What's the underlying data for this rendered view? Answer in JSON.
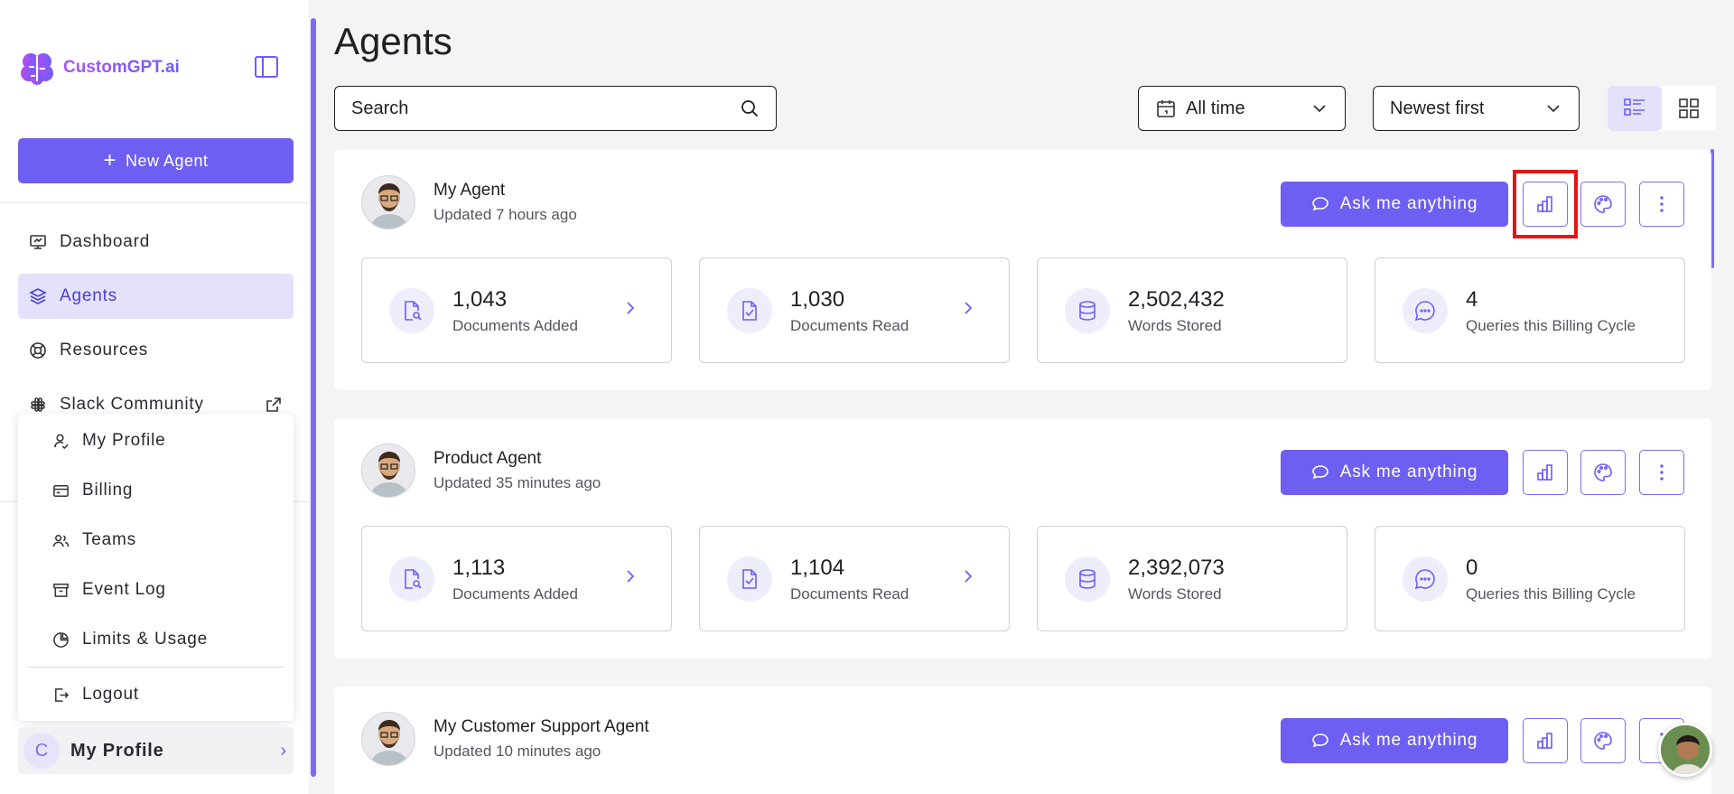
{
  "brand": {
    "name": "CustomGPT.ai"
  },
  "sidebar": {
    "new_agent_label": "New Agent",
    "nav": [
      {
        "label": "Dashboard",
        "icon": "dashboard-icon"
      },
      {
        "label": "Agents",
        "icon": "layers-icon",
        "active": true
      },
      {
        "label": "Resources",
        "icon": "lifebuoy-icon"
      },
      {
        "label": "Slack Community",
        "icon": "slack-icon",
        "external": true
      }
    ],
    "profile_menu": [
      {
        "label": "My Profile",
        "icon": "user-icon"
      },
      {
        "label": "Billing",
        "icon": "card-icon"
      },
      {
        "label": "Teams",
        "icon": "team-icon"
      },
      {
        "label": "Event Log",
        "icon": "archive-icon"
      },
      {
        "label": "Limits & Usage",
        "icon": "pie-icon"
      },
      {
        "label": "Logout",
        "icon": "logout-icon"
      }
    ],
    "profile": {
      "initial": "C",
      "name": "My Profile"
    }
  },
  "main": {
    "title": "Agents",
    "search": {
      "value": "",
      "placeholder": "Search"
    },
    "filter_time": "All time",
    "sort": "Newest first"
  },
  "agents": [
    {
      "name": "My Agent",
      "updated": "Updated 7 hours ago",
      "ask_label": "Ask me anything",
      "stats": [
        {
          "value": "1,043",
          "label": "Documents Added"
        },
        {
          "value": "1,030",
          "label": "Documents Read"
        },
        {
          "value": "2,502,432",
          "label": "Words Stored"
        },
        {
          "value": "4",
          "label": "Queries this Billing Cycle"
        }
      ]
    },
    {
      "name": "Product Agent",
      "updated": "Updated 35 minutes ago",
      "ask_label": "Ask me anything",
      "stats": [
        {
          "value": "1,113",
          "label": "Documents Added"
        },
        {
          "value": "1,104",
          "label": "Documents Read"
        },
        {
          "value": "2,392,073",
          "label": "Words Stored"
        },
        {
          "value": "0",
          "label": "Queries this Billing Cycle"
        }
      ]
    },
    {
      "name": "My Customer Support Agent",
      "updated": "Updated 10 minutes ago",
      "ask_label": "Ask me anything"
    }
  ],
  "colors": {
    "accent": "#6e5ff2",
    "highlight": "#e51515"
  }
}
